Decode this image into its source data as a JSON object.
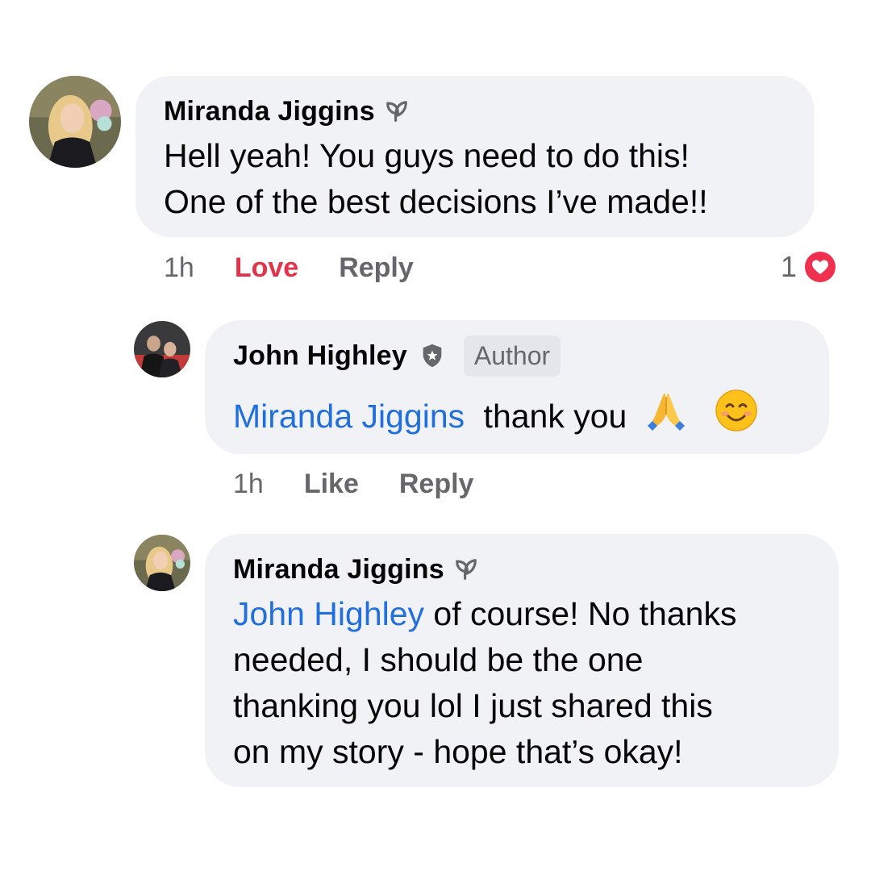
{
  "comments": [
    {
      "author": "Miranda Jiggins",
      "badge_icon": "top-fan-leaf-icon",
      "lines": [
        "Hell yeah! You guys need to do this!",
        "One of the best decisions I’ve made!!"
      ],
      "time": "1h",
      "reaction_label": "Love",
      "reply_label": "Reply",
      "reaction_count": "1",
      "reaction_icon": "heart-icon"
    },
    {
      "author": "John Highley",
      "badge_icon": "shield-star-icon",
      "author_tag": "Author",
      "mention": "Miranda Jiggins",
      "text": "thank you",
      "emojis": [
        "folded-hands-emoji",
        "smiling-face-emoji"
      ],
      "time": "1h",
      "like_label": "Like",
      "reply_label": "Reply"
    },
    {
      "author": "Miranda Jiggins",
      "badge_icon": "top-fan-leaf-icon",
      "mention": "John Highley",
      "line1_rest": " of course! No thanks",
      "lines": [
        "needed, I should be the one",
        "thanking you lol I just shared this",
        "on my story - hope that’s okay!"
      ]
    }
  ],
  "colors": {
    "bubble": "#f0f2f5",
    "mention": "#216fdb",
    "love": "#e2334b",
    "secondary_text": "#65676b"
  }
}
